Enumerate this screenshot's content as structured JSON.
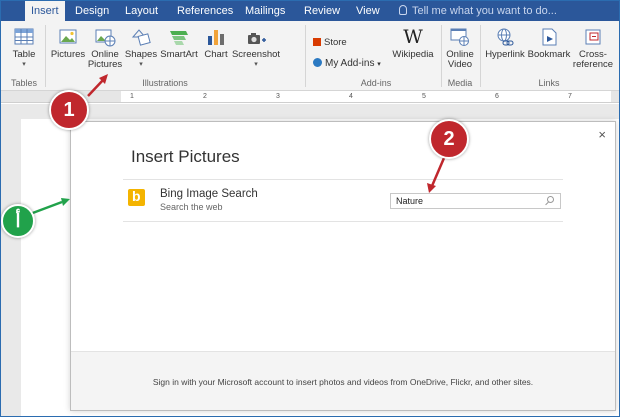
{
  "tabs": [
    "Insert",
    "Design",
    "Layout",
    "References",
    "Mailings",
    "Review",
    "View"
  ],
  "tell_me": "Tell me what you want to do...",
  "ribbon": {
    "table": "Table",
    "pictures": "Pictures",
    "online_pictures_1": "Online",
    "online_pictures_2": "Pictures",
    "shapes": "Shapes",
    "smartart": "SmartArt",
    "chart": "Chart",
    "screenshot": "Screenshot",
    "store": "Store",
    "my_addins": "My Add-ins",
    "wikipedia": "Wikipedia",
    "online_video_1": "Online",
    "online_video_2": "Video",
    "hyperlink": "Hyperlink",
    "bookmark": "Bookmark",
    "cross_ref_1": "Cross-",
    "cross_ref_2": "reference",
    "groups": {
      "tables": "Tables",
      "illustrations": "Illustrations",
      "addins": "Add-ins",
      "media": "Media",
      "links": "Links"
    }
  },
  "ruler_numbers": [
    "1",
    "2",
    "3",
    "4",
    "5",
    "6",
    "7"
  ],
  "dialog": {
    "title": "Insert Pictures",
    "close": "×",
    "bing_name": "Bing Image Search",
    "bing_sub": "Search the web",
    "search_value": "Nature",
    "footer": "Sign in with your Microsoft account to insert photos and videos from OneDrive, Flickr, and other sites."
  },
  "annotations": {
    "badge1": "1",
    "badge2": "2",
    "badge_green": "أ"
  },
  "colors": {
    "tab_bar": "#2b579a",
    "badge_red": "#c0272d",
    "badge_green": "#21a24b",
    "bing": "#f4b400"
  }
}
